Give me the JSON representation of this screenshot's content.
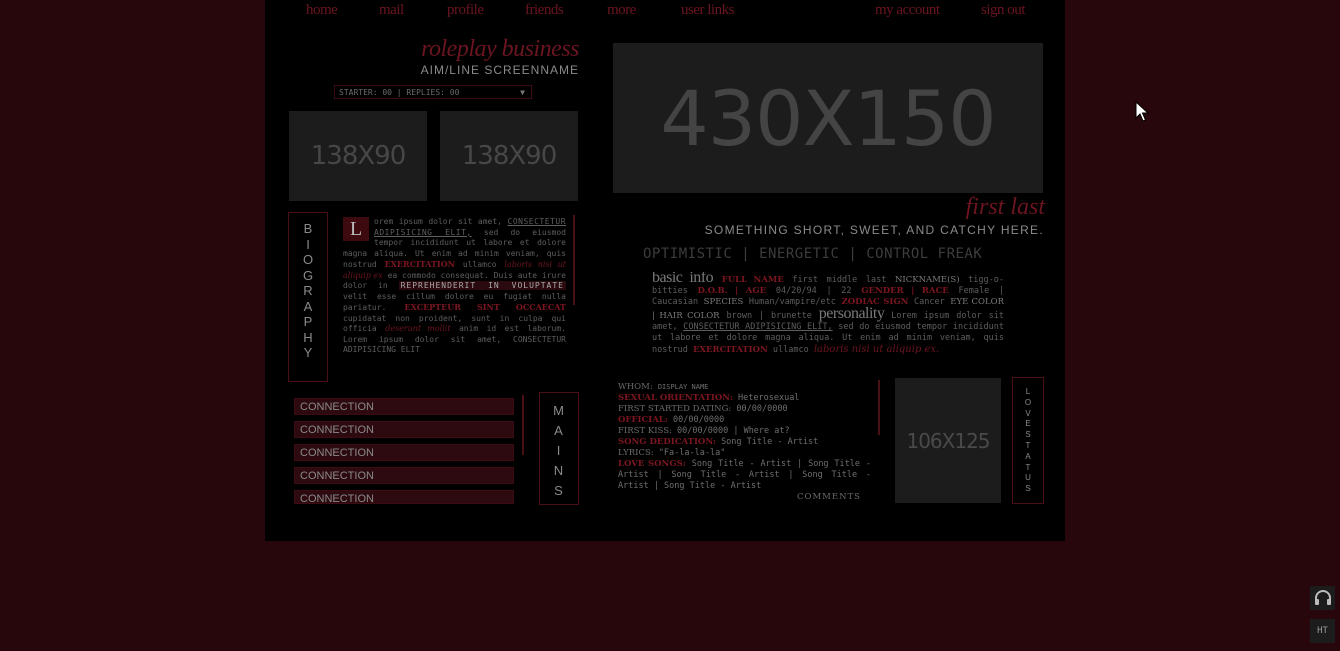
{
  "nav": {
    "home": "home",
    "mail": "mail",
    "profile": "profile",
    "friends": "friends",
    "more": "more",
    "userlinks": "user links",
    "myaccount": "my account",
    "signout": "sign out"
  },
  "header": {
    "title": "roleplay business",
    "subtitle": "AIM/LINE SCREENNAME"
  },
  "thread_select": {
    "value": "STARTER: 00 | REPLIES: 00"
  },
  "placeholders": {
    "main_banner": "430X150",
    "small_left": "138X90",
    "small_right": "138X90",
    "avatar": "106X125"
  },
  "biography": {
    "tab_letters": [
      "B",
      "I",
      "O",
      "G",
      "R",
      "A",
      "P",
      "H",
      "Y"
    ],
    "dropcap": "L",
    "p1": "orem ipsum dolor sit amet,",
    "p1_hl": "CONSECTETUR ADIPISICING ELIT,",
    "p2": "sed do eiusmod tempor incididunt ut labore et dolore magna aliqua. Ut enim ad minim veniam, quis nostrud",
    "p2_red": "EXERCITATION",
    "p3": "ullamco",
    "p3_it": "laboris nisi ut aliquip ex",
    "p4": "ea commodo consequat. Duis aute irure dolor in",
    "p4_hl": "REPREHENDERIT IN VOLUPTATE",
    "p5": "velit esse cillum dolore eu fugiat nulla pariatur.",
    "p5_red": "EXCEPTEUR SINT OCCAECAT",
    "p6": "cupidatat non proident, sunt in culpa qui officia",
    "p6_it": "deserunt mollit",
    "p7": "anim id est laborum. Lorem ipsum dolor sit amet, CONSECTETUR ADIPISICING ELIT"
  },
  "connections": [
    "CONNECTION",
    "CONNECTION",
    "CONNECTION",
    "CONNECTION",
    "CONNECTION"
  ],
  "mains": {
    "tab_letters": [
      "M",
      "A",
      "I",
      "N",
      "S"
    ]
  },
  "character": {
    "name": "first last",
    "tagline": "SOMETHING SHORT, SWEET, AND CATCHY HERE.",
    "traits": "OPTIMISTIC | ENERGETIC | CONTROL FREAK"
  },
  "basic_info": {
    "heading": "basic info",
    "full_name_label": "FULL NAME",
    "full_name_value": "first middle last",
    "nicknames_label": "NICKNAME(S)",
    "nicknames_value": "tigg-o-bitties",
    "dob_label": "D.O.B. | AGE",
    "dob_value": "04/20/94 | 22",
    "gender_label": "GENDER | RACE",
    "gender_value": "Female | Caucasian",
    "species_label": "SPECIES",
    "species_value": "Human/vampire/etc",
    "zodiac_label": "ZODIAC SIGN",
    "zodiac_value": "Cancer",
    "eye_label": "EYE COLOR | HAIR COLOR",
    "eye_value": "brown | brunette",
    "personality_heading": "personality",
    "personality_text": "Lorem ipsum dolor sit amet,",
    "personality_hl": "CONSECTETUR ADIPISICING ELIT,",
    "personality_text2": "sed do eiusmod tempor incididunt ut labore et dolore magna aliqua. Ut enim ad minim veniam, quis nostrud",
    "personality_red": "EXERCITATION",
    "personality_text3": "ullamco",
    "personality_it": "laboris nisi ut aliquip ex."
  },
  "relationship": {
    "whom_label": "WHOM:",
    "whom_value": "DISPLAY NAME",
    "orientation_label": "SEXUAL ORIENTATION:",
    "orientation_value": "Heterosexual",
    "first_dating_label": "FIRST STARTED DATING:",
    "first_dating_value": "00/00/0000",
    "official_label": "OFFICIAL:",
    "official_value": "00/00/0000",
    "first_kiss_label": "FIRST KISS:",
    "first_kiss_value": "00/00/0000 | Where at?",
    "song_label": "SONG DEDICATION:",
    "song_value": "Song Title - Artist",
    "lyrics_label": "LYRICS:",
    "lyrics_value": "\"Fa-la-la-la\"",
    "love_songs_label": "LOVE SONGS:",
    "love_songs_value": "Song Title - Artist | Song Title - Artist | Song Title - Artist | Song Title - Artist | Song Title - Artist",
    "more_label": "COMMENTS"
  },
  "lovestatus": {
    "tab_letters": [
      "L",
      "O",
      "V",
      "E",
      "S",
      "T",
      "A",
      "T",
      "U",
      "S"
    ]
  },
  "side_buttons": {
    "music_icon": "headphones-icon",
    "ht_label": "HT"
  },
  "colors": {
    "background": "#28070c",
    "panel": "#000000",
    "accent": "#6b1520"
  }
}
